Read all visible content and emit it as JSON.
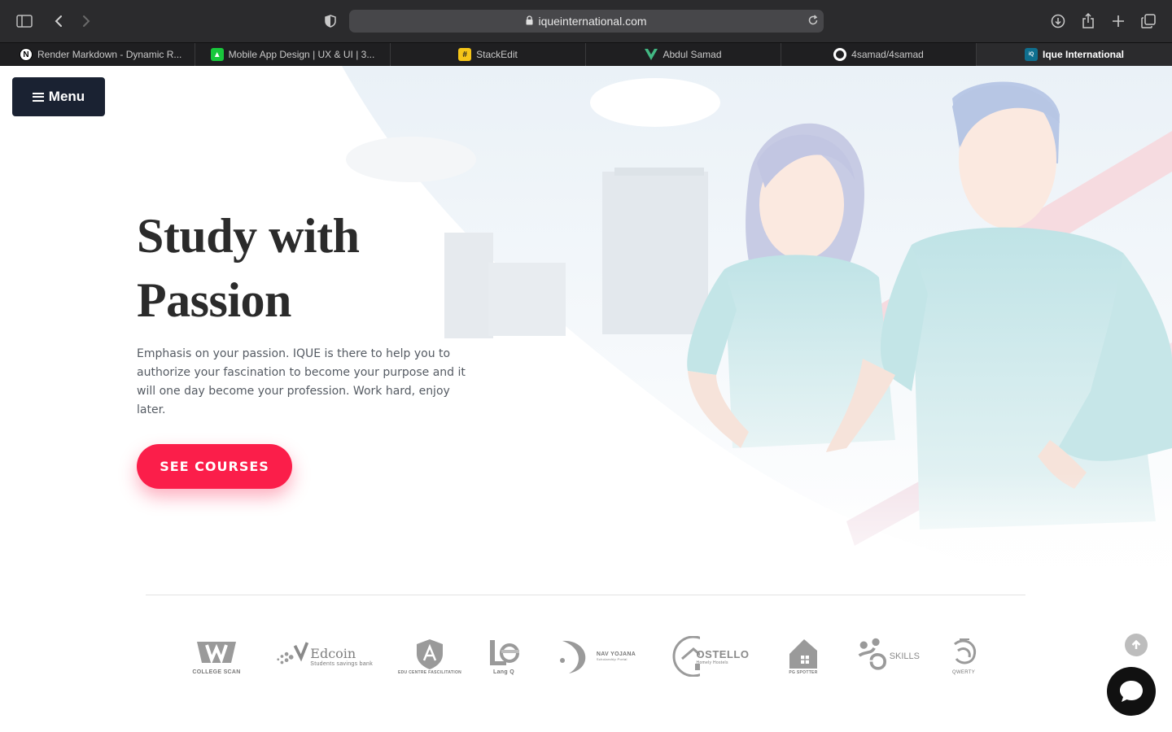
{
  "browser": {
    "url": "iqueinternational.com",
    "tabs": [
      {
        "label": "Render Markdown - Dynamic R...",
        "icon": "notion-n-icon",
        "active": false
      },
      {
        "label": "Mobile App Design | UX & UI | 3...",
        "icon": "green-square-icon",
        "active": false
      },
      {
        "label": "StackEdit",
        "icon": "stackedit-icon",
        "active": false
      },
      {
        "label": "Abdul Samad",
        "icon": "vue-v-icon",
        "active": false
      },
      {
        "label": "4samad/4samad",
        "icon": "github-icon",
        "active": false
      },
      {
        "label": "Ique International",
        "icon": "ique-icon",
        "active": true
      }
    ]
  },
  "nav": {
    "menu_label": "Menu"
  },
  "hero": {
    "title_line1": "Study with",
    "title_line2": "Passion",
    "text": "Emphasis on your passion. IQUE is there to help you to authorize your fascination to become your purpose and it will one day become your profession. Work hard, enjoy later.",
    "cta_label": "SEE COURSES"
  },
  "partners": {
    "college_scan": "COLLEGE SCAN",
    "edcoin": "Edcoin",
    "edcoin_sub": "Students savings bank",
    "edu_centre": "EDU CENTRE FASCILITATION",
    "lang_q": "Lang Q",
    "nav_yojana": "NAV YOJANA",
    "nav_yojana_sub": "Scholarship Portal",
    "ostello": "OSTELLO",
    "ostello_sub": "Homely Hostels",
    "pg_spotter": "PG SPOTTER",
    "qskills": "SKILLS",
    "qwerty": "QWERTY"
  },
  "colors": {
    "accent": "#fb1e4a",
    "menu_bg": "#1a2232",
    "title": "#2b2b2b",
    "body_text": "#555b63"
  }
}
